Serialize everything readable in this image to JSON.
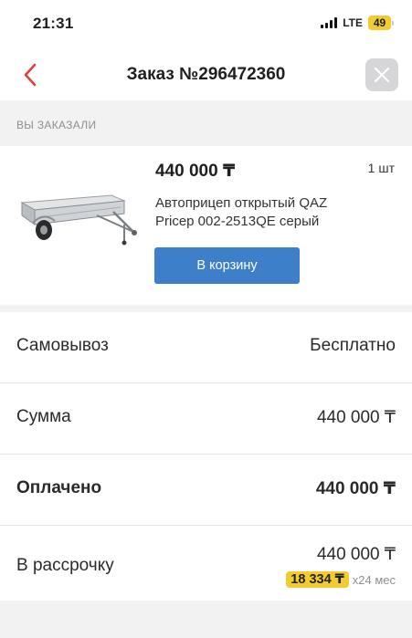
{
  "status_bar": {
    "time": "21:31",
    "network": "LTE",
    "battery": "49"
  },
  "header": {
    "title": "Заказ №296472360",
    "back_icon": "chevron-left-icon",
    "close_icon": "close-icon"
  },
  "section": {
    "title": "ВЫ ЗАКАЗАЛИ"
  },
  "product": {
    "price": "440 000 ₸",
    "quantity": "1 шт",
    "name": "Автоприцеп открытый QAZ Pricep 002-2513QE серый",
    "add_to_cart_label": "В корзину"
  },
  "summary": {
    "delivery": {
      "label": "Самовывоз",
      "value": "Бесплатно"
    },
    "sum": {
      "label": "Сумма",
      "value": "440 000 ₸"
    },
    "paid": {
      "label": "Оплачено",
      "value": "440 000 ₸"
    },
    "installment": {
      "label": "В рассрочку",
      "value": "440 000 ₸",
      "monthly": "18 334 ₸",
      "term": "x24 мес"
    }
  },
  "colors": {
    "accent_red": "#d9443c",
    "button_blue": "#3d7fc9",
    "badge_yellow": "#f2cc2f"
  }
}
